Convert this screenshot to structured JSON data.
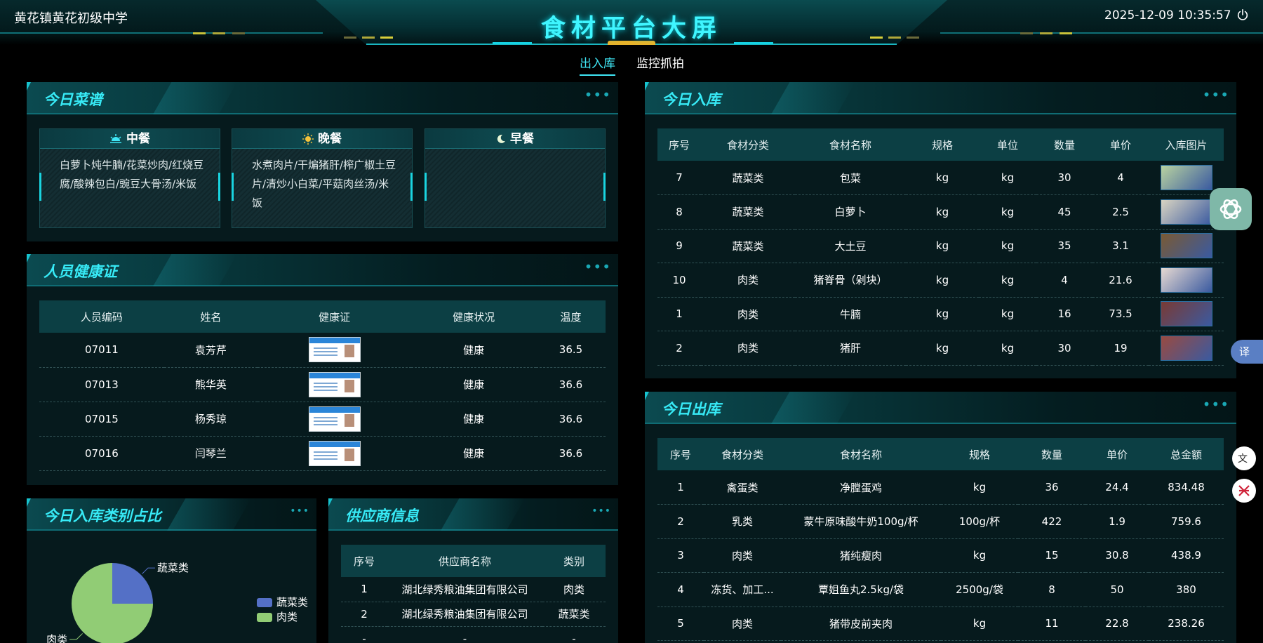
{
  "header": {
    "school": "黄花镇黄花初级中学",
    "title": "食材平台大屏",
    "datetime": "2025-12-09 10:35:57"
  },
  "tabs": [
    {
      "label": "出入库",
      "active": true
    },
    {
      "label": "监控抓拍",
      "active": false
    }
  ],
  "menu": {
    "title": "今日菜谱",
    "meals": [
      {
        "name": "中餐",
        "icon": "sunrise-icon",
        "dishes": "白萝卜炖牛腩/花菜炒肉/红烧豆腐/酸辣包白/豌豆大骨汤/米饭"
      },
      {
        "name": "晚餐",
        "icon": "sun-icon",
        "dishes": "水煮肉片/干煸猪肝/榨广椒土豆片/清炒小白菜/平菇肉丝汤/米饭"
      },
      {
        "name": "早餐",
        "icon": "moon-icon",
        "dishes": ""
      }
    ]
  },
  "health": {
    "title": "人员健康证",
    "columns": [
      "人员编码",
      "姓名",
      "健康证",
      "健康状况",
      "温度"
    ],
    "rows": [
      {
        "code": "07011",
        "name": "袁芳芹",
        "status": "健康",
        "temp": "36.5"
      },
      {
        "code": "07013",
        "name": "熊华英",
        "status": "健康",
        "temp": "36.6"
      },
      {
        "code": "07015",
        "name": "杨秀琼",
        "status": "健康",
        "temp": "36.6"
      },
      {
        "code": "07016",
        "name": "闫琴兰",
        "status": "健康",
        "temp": "36.6"
      }
    ]
  },
  "category_chart": {
    "title": "今日入库类别占比"
  },
  "chart_data": {
    "type": "pie",
    "categories": [
      "蔬菜类",
      "肉类"
    ],
    "values": [
      25,
      75
    ],
    "legend_position": "right",
    "colors": [
      "#5470c6",
      "#91cc75"
    ]
  },
  "supplier": {
    "title": "供应商信息",
    "columns": [
      "序号",
      "供应商名称",
      "类别"
    ],
    "rows": [
      {
        "no": "1",
        "name": "湖北绿秀粮油集团有限公司",
        "type": "肉类"
      },
      {
        "no": "2",
        "name": "湖北绿秀粮油集团有限公司",
        "type": "蔬菜类"
      },
      {
        "no": "-",
        "name": "-",
        "type": "-"
      }
    ]
  },
  "stock_in": {
    "title": "今日入库",
    "columns": [
      "序号",
      "食材分类",
      "食材名称",
      "规格",
      "单位",
      "数量",
      "单价",
      "入库图片"
    ],
    "rows": [
      {
        "no": "7",
        "cat": "蔬菜类",
        "name": "包菜",
        "spec": "kg",
        "unit": "kg",
        "qty": "30",
        "price": "4",
        "img": "#b9d3a0"
      },
      {
        "no": "8",
        "cat": "蔬菜类",
        "name": "白萝卜",
        "spec": "kg",
        "unit": "kg",
        "qty": "45",
        "price": "2.5",
        "img": "#d9d4c2"
      },
      {
        "no": "9",
        "cat": "蔬菜类",
        "name": "大土豆",
        "spec": "kg",
        "unit": "kg",
        "qty": "35",
        "price": "3.1",
        "img": "#7a5a33"
      },
      {
        "no": "10",
        "cat": "肉类",
        "name": "猪脊骨（剁块）",
        "spec": "kg",
        "unit": "kg",
        "qty": "4",
        "price": "21.6",
        "img": "#e6d9d2"
      },
      {
        "no": "1",
        "cat": "肉类",
        "name": "牛腩",
        "spec": "kg",
        "unit": "kg",
        "qty": "16",
        "price": "73.5",
        "img": "#7a3a34"
      },
      {
        "no": "2",
        "cat": "肉类",
        "name": "猪肝",
        "spec": "kg",
        "unit": "kg",
        "qty": "30",
        "price": "19",
        "img": "#9a4a40"
      }
    ]
  },
  "stock_out": {
    "title": "今日出库",
    "columns": [
      "序号",
      "食材分类",
      "食材名称",
      "规格",
      "数量",
      "单价",
      "总金额"
    ],
    "rows": [
      {
        "no": "1",
        "cat": "禽蛋类",
        "name": "净膛蛋鸡",
        "spec": "kg",
        "qty": "36",
        "price": "24.4",
        "total": "834.48"
      },
      {
        "no": "2",
        "cat": "乳类",
        "name": "蒙牛原味酸牛奶100g/杯",
        "spec": "100g/杯",
        "qty": "422",
        "price": "1.9",
        "total": "759.6"
      },
      {
        "no": "3",
        "cat": "肉类",
        "name": "猪纯瘦肉",
        "spec": "kg",
        "qty": "15",
        "price": "30.8",
        "total": "438.9"
      },
      {
        "no": "4",
        "cat": "冻货、加工...",
        "name": "覃姐鱼丸2.5kg/袋",
        "spec": "2500g/袋",
        "qty": "8",
        "price": "50",
        "total": "380"
      },
      {
        "no": "5",
        "cat": "肉类",
        "name": "猪带皮前夹肉",
        "spec": "kg",
        "qty": "11",
        "price": "22.8",
        "total": "238.26"
      }
    ]
  },
  "widgets": {
    "translate_label": "译",
    "more_dots": "•••"
  }
}
